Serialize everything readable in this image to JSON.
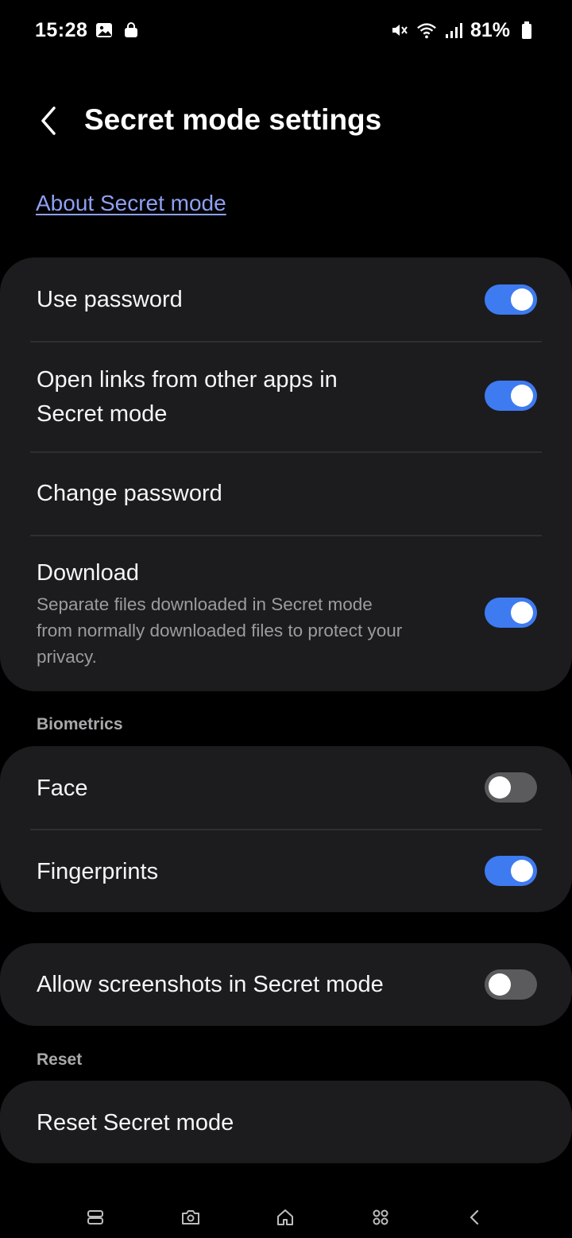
{
  "status_bar": {
    "time": "15:28",
    "battery": "81%",
    "left_icons": [
      "gallery-icon",
      "shopping-bag-icon"
    ],
    "right_icons": [
      "mute-icon",
      "wifi-icon",
      "signal-icon",
      "battery-icon"
    ]
  },
  "header": {
    "title": "Secret mode settings",
    "back_icon": "chevron-left-icon"
  },
  "about_link": "About Secret mode",
  "settings": {
    "use_password": {
      "label": "Use password",
      "enabled": true
    },
    "open_links": {
      "label_line1": "Open links from other apps in",
      "label_line2": "Secret mode",
      "enabled": true
    },
    "change_password": {
      "label": "Change password"
    },
    "download": {
      "label": "Download",
      "sub_line1": "Separate files downloaded in Secret mode",
      "sub_line2": "from normally downloaded files to protect your",
      "sub_line3": "privacy.",
      "enabled": true
    }
  },
  "biometrics": {
    "section_label": "Biometrics",
    "face": {
      "label": "Face",
      "enabled": false
    },
    "fingerprints": {
      "label": "Fingerprints",
      "enabled": true
    }
  },
  "screenshots": {
    "label": "Allow screenshots in Secret mode",
    "enabled": false
  },
  "reset": {
    "section_label": "Reset",
    "reset_secret_mode": {
      "label": "Reset Secret mode"
    }
  },
  "nav_bar": {
    "icons": [
      "tabs-icon",
      "camera-icon",
      "home-icon",
      "grid-icon",
      "back-icon"
    ]
  },
  "colors": {
    "background": "#000000",
    "card": "#1c1c1e",
    "accent_toggle": "#3e7bf1",
    "link": "#8f9ff2",
    "secondary_text": "#9c9c9e"
  }
}
